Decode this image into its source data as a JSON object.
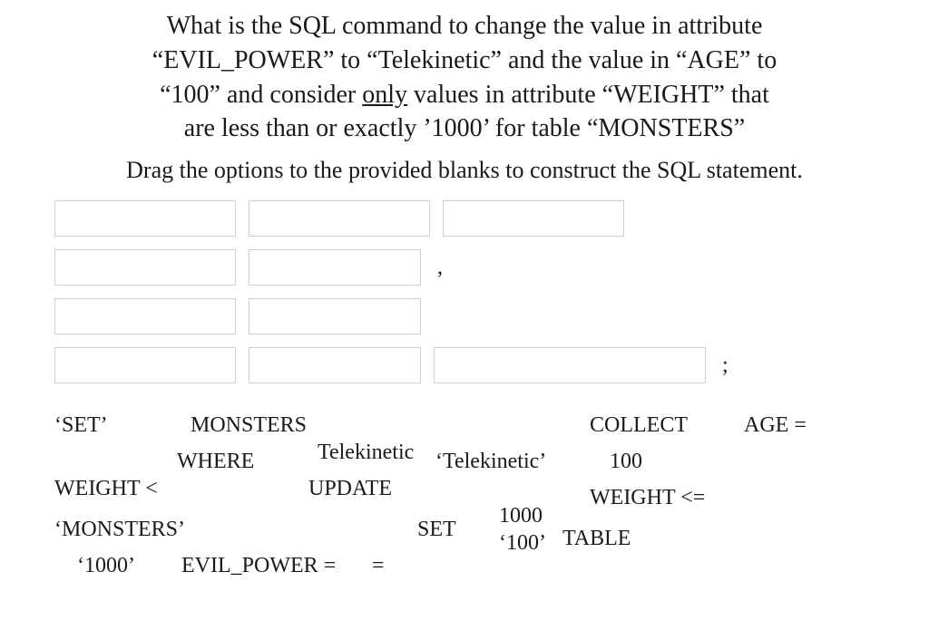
{
  "question": {
    "line1": "What is the SQL command to change the value in attribute",
    "line2a": "“EVIL_POWER” to “Telekinetic” and the value in “AGE” to",
    "line3a": "“100” and consider ",
    "line3_underlined": "only",
    "line3b": " values in attribute “WEIGHT” that",
    "line4": "are less than or exactly ’1000’ for table “MONSTERS”"
  },
  "instruction": "Drag the options to the provided blanks to construct the SQL statement.",
  "punct_comma": ",",
  "punct_semicolon": ";",
  "options": {
    "set_quoted": "‘SET’",
    "monsters": "MONSTERS",
    "collect": "COLLECT",
    "age_eq": "AGE =",
    "where": "WHERE",
    "telekinetic": "Telekinetic",
    "telekinetic_quoted": "‘Telekinetic’",
    "hundred": "100",
    "weight_lt": "WEIGHT <",
    "update": "UPDATE",
    "weight_lte": "WEIGHT <=",
    "monsters_quoted": "‘MONSTERS’",
    "set": "SET",
    "thousand": "1000",
    "hundred_quoted": "‘100’",
    "table": "TABLE",
    "thousand_quoted": "‘1000’",
    "evil_power_eq": "EVIL_POWER =",
    "eq": "="
  }
}
